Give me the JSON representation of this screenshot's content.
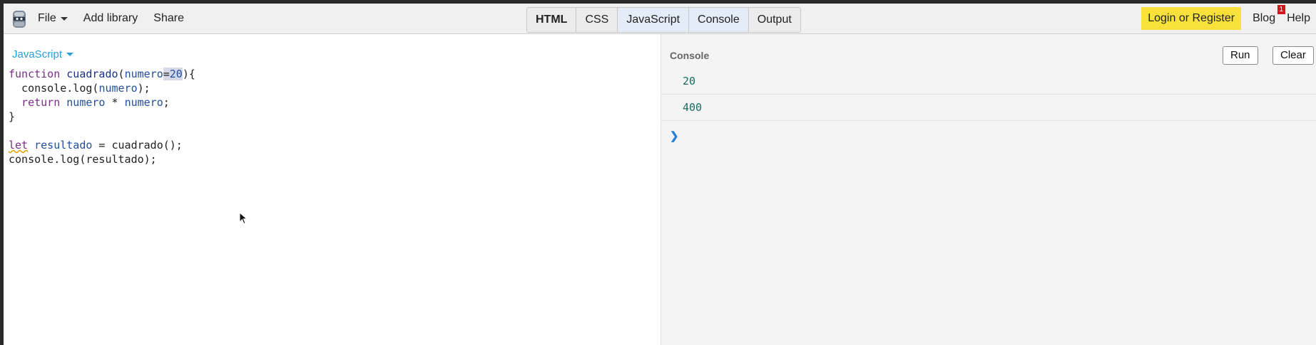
{
  "topbar": {
    "menu": [
      {
        "label": "File",
        "has_dropdown": true
      },
      {
        "label": "Add library",
        "has_dropdown": false
      },
      {
        "label": "Share",
        "has_dropdown": false
      }
    ],
    "tabs": [
      {
        "label": "HTML",
        "active": false
      },
      {
        "label": "CSS",
        "active": false
      },
      {
        "label": "JavaScript",
        "active": true
      },
      {
        "label": "Console",
        "active": true
      },
      {
        "label": "Output",
        "active": false
      }
    ],
    "login_label": "Login or Register",
    "blog_label": "Blog",
    "blog_badge": "1",
    "help_label": "Help",
    "accent_login": "#f7e13a",
    "accent_badge": "#d3141f"
  },
  "editor": {
    "language_label": "JavaScript",
    "code": {
      "l1_kw": "function",
      "l1_fn": "cuadrado",
      "l1_open": "(",
      "l1_param": "numero",
      "l1_eq": "=",
      "l1_default": "20",
      "l1_close": "){",
      "l2_a": "  console.log(",
      "l2_var": "numero",
      "l2_b": ");",
      "l3_kw": "  return",
      "l3_sp1": " ",
      "l3_var1": "numero",
      "l3_op": " * ",
      "l3_var2": "numero",
      "l3_end": ";",
      "l4": "}",
      "l6_kw": "let",
      "l6_sp": " ",
      "l6_var": "resultado",
      "l6_rest": " = cuadrado();",
      "l7": "console.log(resultado);"
    }
  },
  "console": {
    "title": "Console",
    "run_label": "Run",
    "clear_label": "Clear",
    "logs": [
      "20",
      "400"
    ],
    "prompt_symbol": "❯"
  }
}
